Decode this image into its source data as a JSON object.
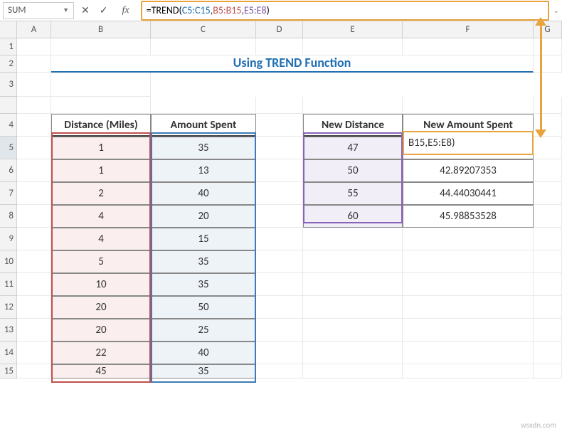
{
  "name_box": "SUM",
  "formula": {
    "raw": "=TREND(C5:C15,B5:B15,E5:E8)",
    "equals": "=",
    "fn": "TREND",
    "open": "(",
    "ref1": "C5:C15",
    "sep1": ",",
    "ref2": "B5:B15",
    "sep2": ",",
    "ref3": "E5:E8",
    "close": ")"
  },
  "columns": [
    "A",
    "B",
    "C",
    "D",
    "E",
    "F",
    "G"
  ],
  "rows": [
    "1",
    "2",
    "3",
    "4",
    "5",
    "6",
    "7",
    "8",
    "9",
    "10",
    "11",
    "12",
    "13",
    "14",
    "15"
  ],
  "title": "Using TREND Function",
  "table1": {
    "headers": {
      "b": "Distance (Miles)",
      "c": "Amount Spent"
    },
    "data": [
      {
        "b": "1",
        "c": "35"
      },
      {
        "b": "1",
        "c": "13"
      },
      {
        "b": "2",
        "c": "40"
      },
      {
        "b": "4",
        "c": "20"
      },
      {
        "b": "4",
        "c": "15"
      },
      {
        "b": "5",
        "c": "35"
      },
      {
        "b": "10",
        "c": "35"
      },
      {
        "b": "20",
        "c": "50"
      },
      {
        "b": "20",
        "c": "25"
      },
      {
        "b": "22",
        "c": "40"
      },
      {
        "b": "45",
        "c": "35"
      }
    ]
  },
  "table2": {
    "headers": {
      "e": "New Distance",
      "f": "New Amount Spent"
    },
    "data": [
      {
        "e": "47",
        "f": "B15,E5:E8)"
      },
      {
        "e": "50",
        "f": "42.89207353"
      },
      {
        "e": "55",
        "f": "44.44030441"
      },
      {
        "e": "60",
        "f": "45.98853528"
      }
    ]
  },
  "edit_cell_display": "B15,E5:E8)",
  "watermark": "wsxdn.com"
}
